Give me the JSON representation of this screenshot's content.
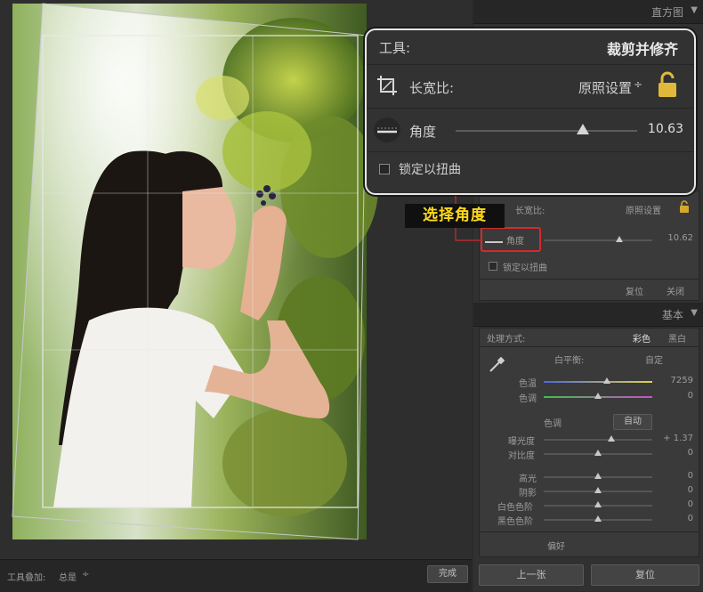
{
  "zoom": {
    "title": "工具:",
    "tool_name": "裁剪并修齐",
    "aspect_label": "长宽比:",
    "aspect_value": "原照设置",
    "angle_label": "角度",
    "angle_value": "10.63",
    "angle_fraction": 0.7,
    "lock_label": "锁定以扭曲"
  },
  "callout": "选择角度",
  "panel": {
    "histogram_header": "直方图",
    "crop": {
      "aspect_label": "长宽比:",
      "aspect_value": "原照设置",
      "angle_label": "角度",
      "angle_value": "10.62",
      "angle_fraction": 0.7,
      "lock_label": "锁定以扭曲",
      "reset_button": "复位",
      "close_button": "关闭"
    },
    "basic": {
      "header": "基本",
      "treatment_label": "处理方式:",
      "color_option": "彩色",
      "bw_option": "黑白",
      "wb_label": "白平衡:",
      "wb_value": "自定",
      "temp_label": "色温",
      "temp_value": "7259",
      "temp_fraction": 0.58,
      "tint_label": "色调",
      "tint_value": "0",
      "tint_fraction": 0.5,
      "tone_label": "色调",
      "auto_button": "自动",
      "exposure_label": "曝光度",
      "exposure_value": "+ 1.37",
      "exposure_fraction": 0.62,
      "contrast_label": "对比度",
      "contrast_value": "0",
      "contrast_fraction": 0.5,
      "highlights_label": "高光",
      "highlights_value": "0",
      "highlights_fraction": 0.5,
      "shadows_label": "阴影",
      "shadows_value": "0",
      "shadows_fraction": 0.5,
      "whites_label": "白色色阶",
      "whites_value": "0",
      "whites_fraction": 0.5,
      "blacks_label": "黑色色阶",
      "blacks_value": "0",
      "blacks_fraction": 0.5,
      "presence_label": "偏好"
    },
    "previous_button": "上一张",
    "reset_all_button": "复位"
  },
  "toolbar": {
    "overlay_label": "工具叠加:",
    "overlay_value": "总是",
    "done_button": "完成"
  },
  "colors": {
    "accent": "#ffd81a",
    "highlight_box": "#d42a2a"
  }
}
